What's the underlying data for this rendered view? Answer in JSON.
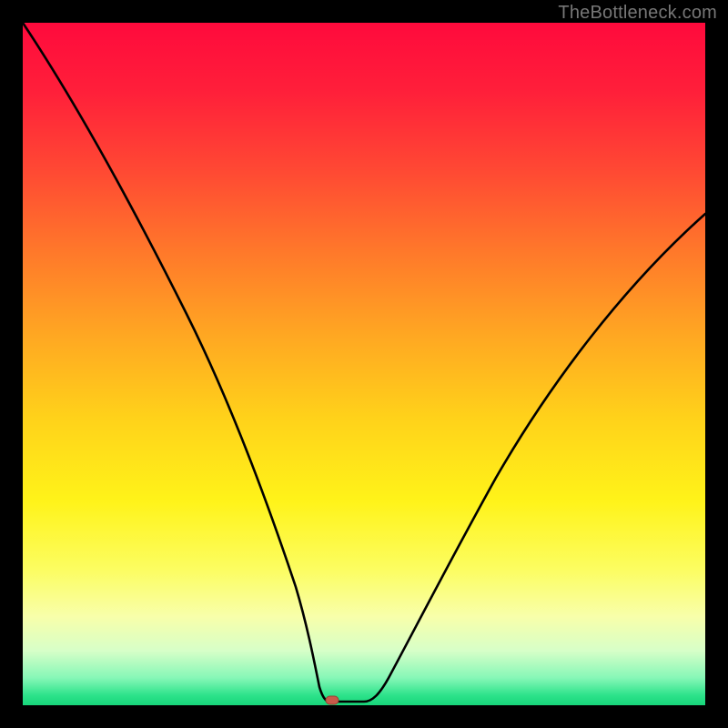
{
  "watermark": "TheBottleneck.com",
  "chart_data": {
    "type": "line",
    "title": "",
    "xlabel": "",
    "ylabel": "",
    "xlim": [
      0,
      100
    ],
    "ylim": [
      0,
      100
    ],
    "grid": false,
    "legend": false,
    "gradient_stops": [
      {
        "pos": 0,
        "color": "#ff0a3c"
      },
      {
        "pos": 0.22,
        "color": "#ff4a33"
      },
      {
        "pos": 0.46,
        "color": "#ffa822"
      },
      {
        "pos": 0.7,
        "color": "#fff319"
      },
      {
        "pos": 0.92,
        "color": "#d7ffc8"
      },
      {
        "pos": 1.0,
        "color": "#17d57a"
      }
    ],
    "series": [
      {
        "name": "bottleneck-curve",
        "x": [
          0,
          5,
          10,
          15,
          20,
          25,
          30,
          35,
          38,
          40,
          41.5,
          43,
          45,
          50,
          55,
          60,
          65,
          70,
          75,
          80,
          85,
          90,
          95,
          100
        ],
        "values": [
          100,
          92,
          83,
          73,
          63,
          52,
          41,
          28,
          18,
          10,
          4,
          1,
          0.5,
          0.5,
          5,
          12,
          20,
          28,
          36,
          44,
          52,
          59,
          66,
          72
        ]
      }
    ],
    "marker": {
      "name": "optimal-point",
      "x": 45,
      "y": 0.5,
      "color": "#cc5a4a"
    }
  }
}
